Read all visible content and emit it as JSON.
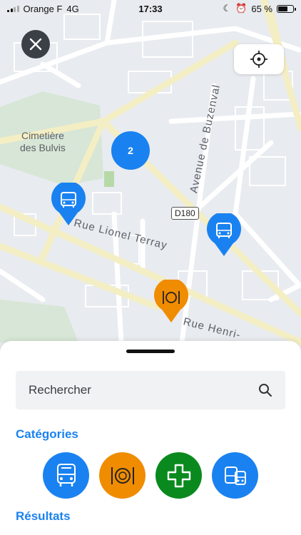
{
  "status_bar": {
    "carrier": "Orange F",
    "network": "4G",
    "time": "17:33",
    "battery": "65 %",
    "battery_level": 0.65,
    "icons": [
      "signal-icon",
      "moon-icon",
      "alarm-icon",
      "battery-icon"
    ]
  },
  "map": {
    "labels": {
      "cemetery_line1": "Cimetière",
      "cemetery_line2": "des Bulvis",
      "avenue": "Avenue de Buzenval",
      "rue_lionel": "Rue Lionel Terray",
      "rue_henri": "Rue Henri-",
      "road_shield": "D180"
    },
    "cluster_count": "2",
    "markers": [
      {
        "type": "bus",
        "color": "#1a82f0",
        "icon": "bus-icon"
      },
      {
        "type": "bus",
        "color": "#1a82f0",
        "icon": "bus-icon"
      },
      {
        "type": "restaurant",
        "color": "#f08c00",
        "icon": "restaurant-icon"
      }
    ]
  },
  "controls": {
    "close_icon": "close-icon",
    "locate_icon": "locate-crosshair-icon"
  },
  "sheet": {
    "search_placeholder": "Rechercher",
    "categories_title": "Catégories",
    "results_title": "Résultats",
    "categories": [
      {
        "name": "bus",
        "color": "#1a82f0",
        "icon": "bus-icon"
      },
      {
        "name": "restaurant",
        "color": "#f08c00",
        "icon": "restaurant-icon"
      },
      {
        "name": "pharmacy",
        "color": "#0a8a1e",
        "icon": "cross-icon"
      },
      {
        "name": "train",
        "color": "#1a82f0",
        "icon": "train-icon"
      }
    ]
  },
  "colors": {
    "accent": "#1a82f0",
    "orange": "#f08c00",
    "green": "#0a8a1e"
  }
}
